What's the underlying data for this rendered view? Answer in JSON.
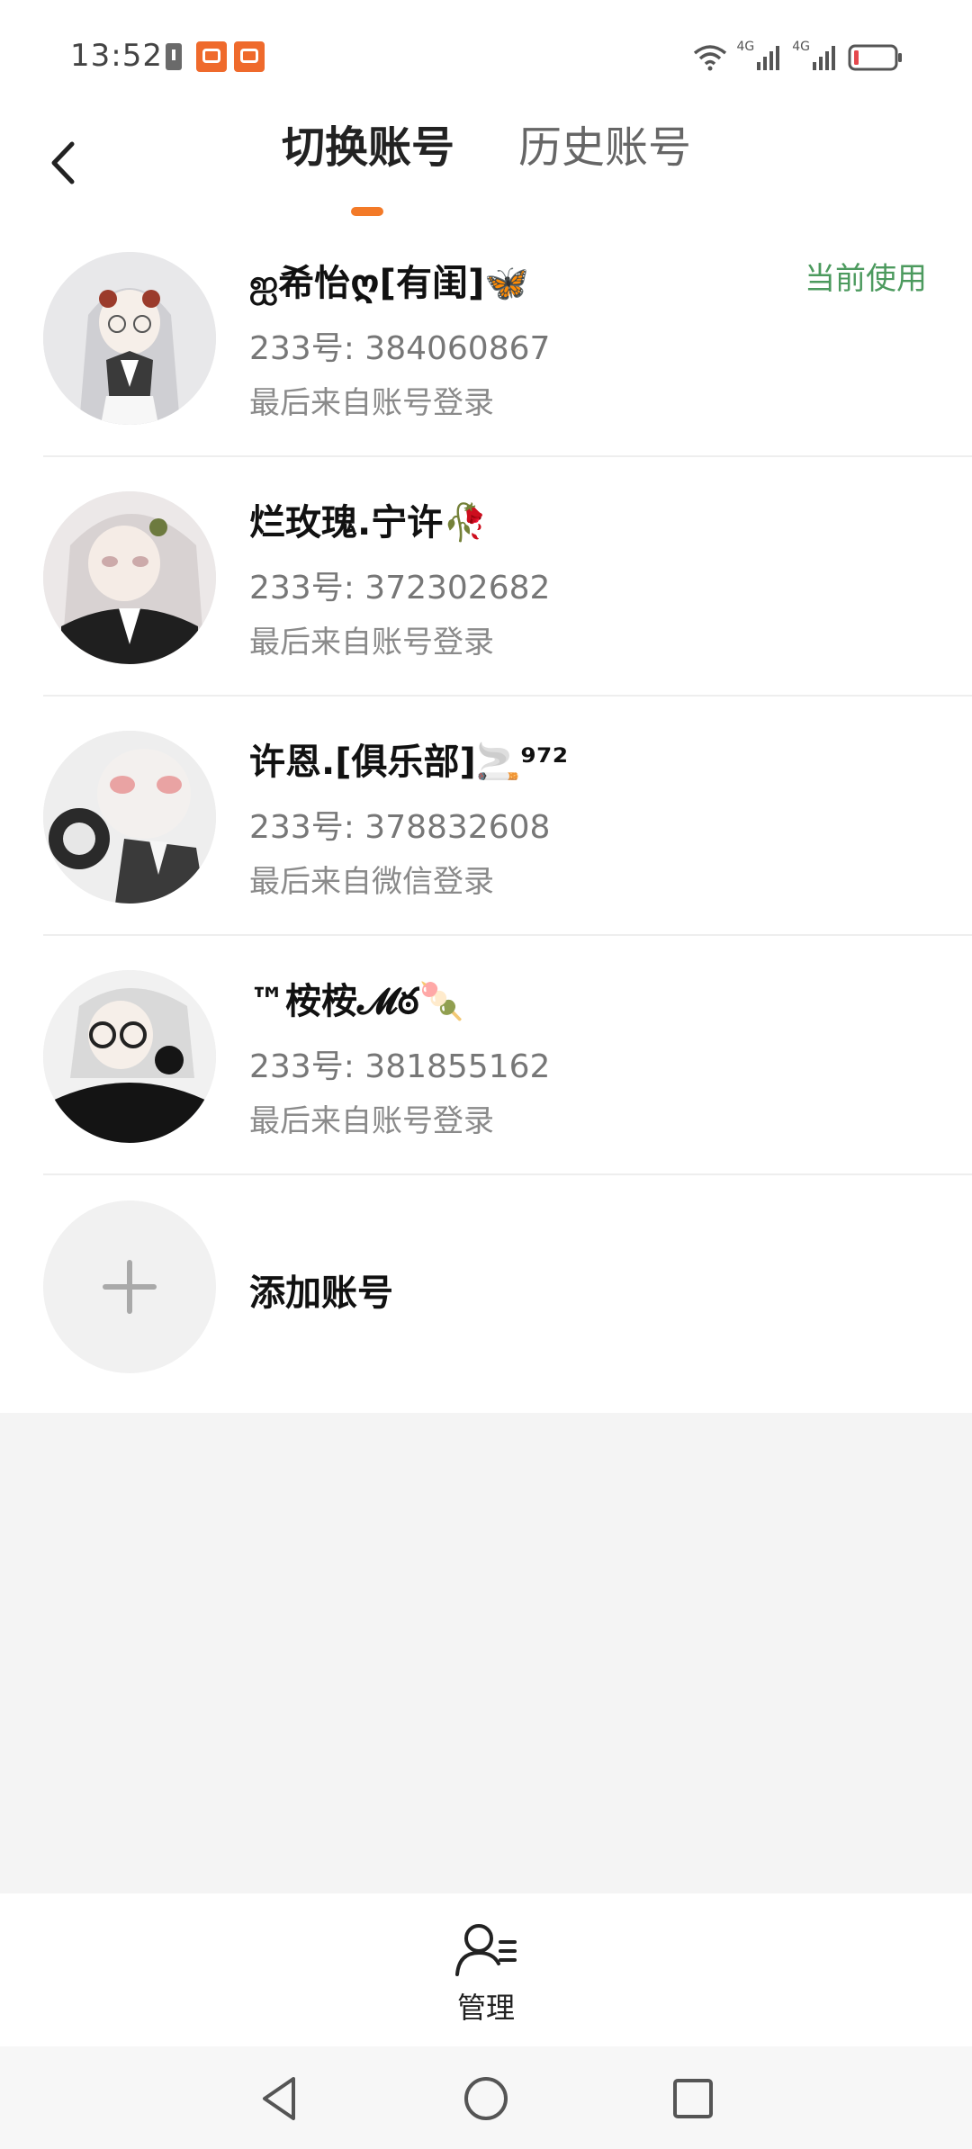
{
  "status_bar": {
    "time": "13:52",
    "network_1": "4G",
    "network_2": "4G"
  },
  "header": {
    "tabs": [
      {
        "label": "切换账号",
        "active": true
      },
      {
        "label": "历史账号",
        "active": false
      }
    ],
    "accent_color": "#f37a28"
  },
  "accounts": [
    {
      "name": "ஐ希怡ღ[有闺]🦋",
      "id_label": "233号: 384060867",
      "login_source": "最后来自账号登录",
      "badge": "当前使用"
    },
    {
      "name": "烂玫瑰.宁许🥀",
      "id_label": "233号: 372302682",
      "login_source": "最后来自账号登录"
    },
    {
      "name": "许恩.[俱乐部]🚬⁹⁷²",
      "id_label": "233号: 378832608",
      "login_source": "最后来自微信登录"
    },
    {
      "name": "™桉桉𝓜ఠ🍡",
      "id_label": "233号: 381855162",
      "login_source": "最后来自账号登录"
    }
  ],
  "add_account": {
    "label": "添加账号",
    "icon": "plus-icon"
  },
  "bottom": {
    "manage_label": "管理",
    "manage_icon": "user-list-icon"
  },
  "nav": {
    "back_icon": "triangle-back-icon",
    "home_icon": "circle-home-icon",
    "recent_icon": "square-recent-icon"
  },
  "colors": {
    "current_badge": "#4c9a5e",
    "divider": "#eeeeee",
    "page_background": "#f4f4f4"
  }
}
